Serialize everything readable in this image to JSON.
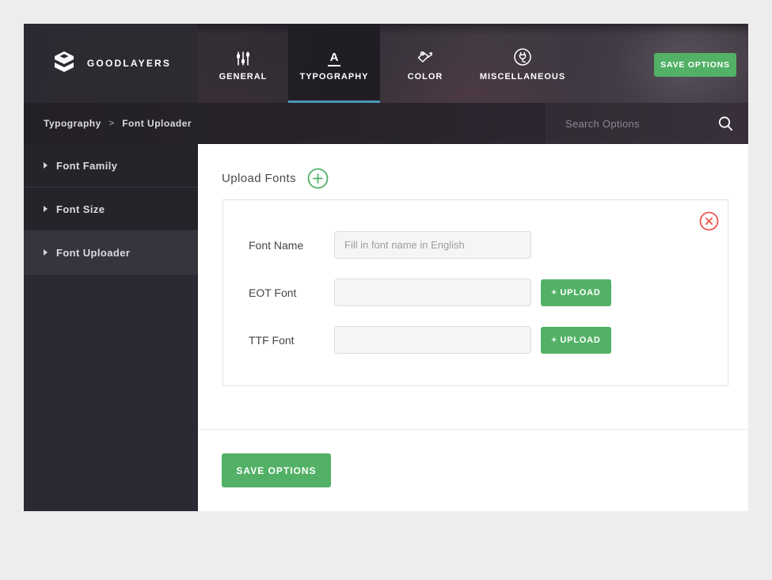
{
  "header": {
    "brand": "GOODLAYERS",
    "save_button": "SAVE OPTIONS",
    "tabs": [
      {
        "label": "GENERAL",
        "icon": "sliders-icon",
        "active": false
      },
      {
        "label": "TYPOGRAPHY",
        "icon": "typography-a-icon",
        "icon_glyph": "A",
        "active": true
      },
      {
        "label": "COLOR",
        "icon": "paint-bucket-icon",
        "active": false
      },
      {
        "label": "MISCELLANEOUS",
        "icon": "plug-icon",
        "active": false
      }
    ]
  },
  "breadcrumb": {
    "section": "Typography",
    "separator": ">",
    "page": "Font Uploader"
  },
  "search": {
    "placeholder": "Search Options",
    "icon": "search-icon"
  },
  "sidebar": {
    "items": [
      {
        "label": "Font Family",
        "active": false
      },
      {
        "label": "Font Size",
        "active": false
      },
      {
        "label": "Font Uploader",
        "active": true
      }
    ]
  },
  "main": {
    "section_title": "Upload Fonts",
    "add_icon": "plus-circle-icon",
    "card": {
      "remove_icon": "close-circle-icon",
      "fields": [
        {
          "label": "Font Name",
          "placeholder": "Fill in font name in English",
          "has_upload": false
        },
        {
          "label": "EOT Font",
          "placeholder": "",
          "has_upload": true
        },
        {
          "label": "TTF Font",
          "placeholder": "",
          "has_upload": true
        }
      ],
      "upload_button_label": "+ UPLOAD"
    },
    "save_button": "SAVE OPTIONS"
  },
  "colors": {
    "accent_green": "#52b166",
    "tab_underline_blue": "#4a96ba",
    "danger_red": "#ec5550",
    "header_dark": "#2c2932",
    "sidebar_dark": "#2b2933"
  }
}
